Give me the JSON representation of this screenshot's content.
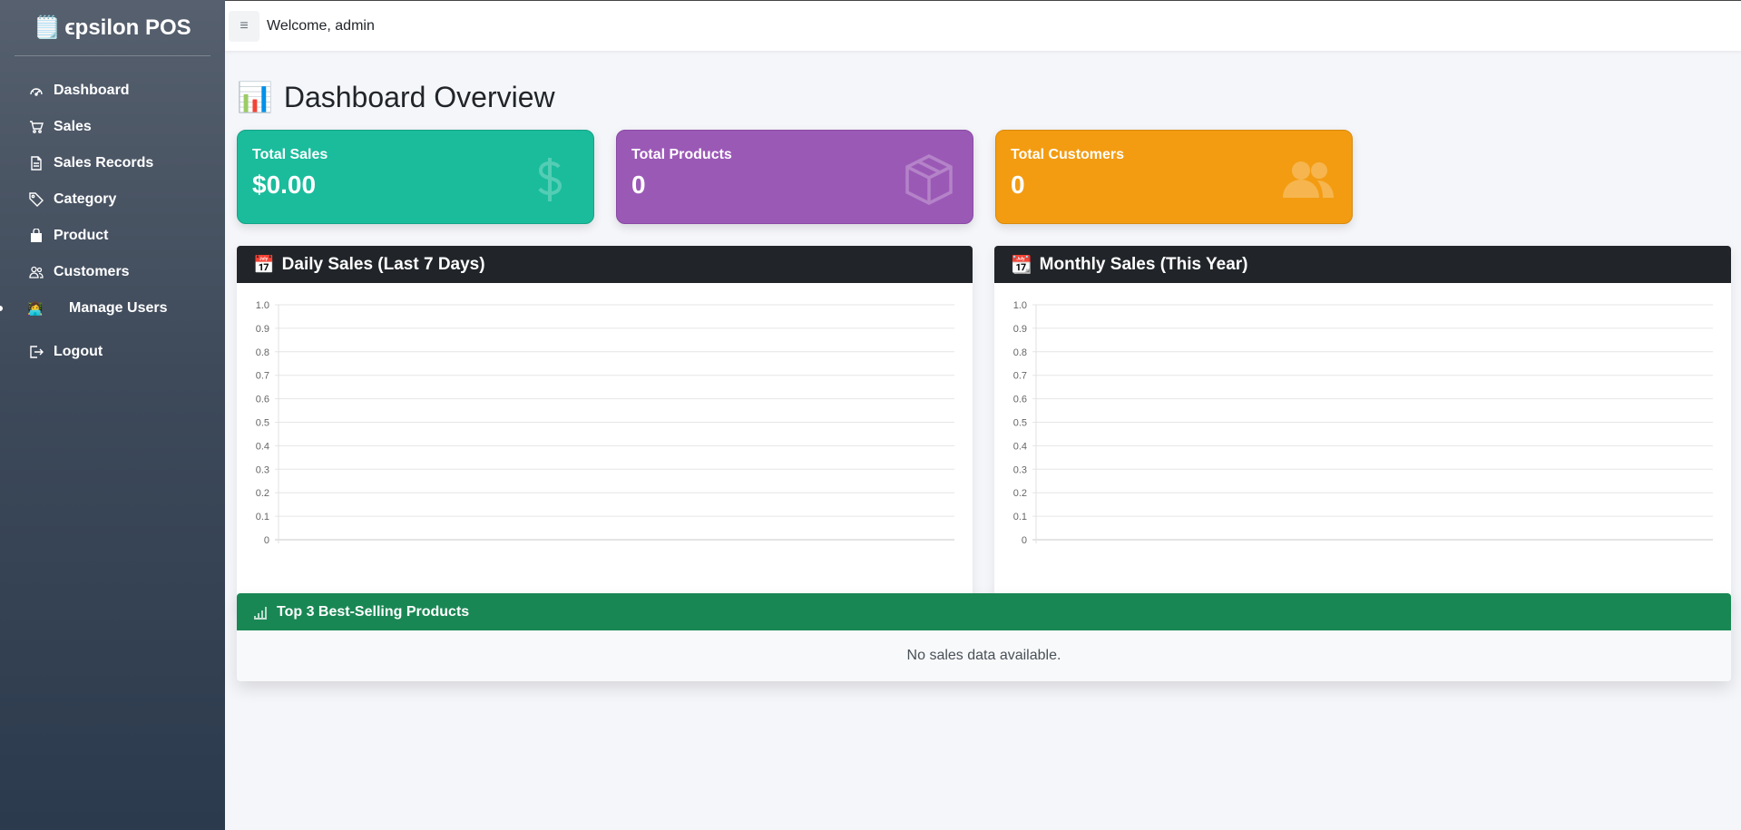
{
  "brand": {
    "icon": "🗒️",
    "name": "ϵpsilon POS"
  },
  "sidebar": {
    "items": [
      {
        "label": "Dashboard",
        "icon": "speedometer-icon"
      },
      {
        "label": "Sales",
        "icon": "cart-icon"
      },
      {
        "label": "Sales Records",
        "icon": "document-icon"
      },
      {
        "label": "Category",
        "icon": "tag-icon"
      },
      {
        "label": "Product",
        "icon": "bag-icon"
      },
      {
        "label": "Customers",
        "icon": "people-icon"
      },
      {
        "label": "Manage Users",
        "icon": "👩‍💻"
      },
      {
        "label": "Logout",
        "icon": "logout-icon"
      }
    ]
  },
  "topbar": {
    "menu_icon": "≡",
    "welcome": "Welcome, admin"
  },
  "page": {
    "title_icon": "📊",
    "title": "Dashboard Overview"
  },
  "cards": [
    {
      "label": "Total Sales",
      "value": "$0.00",
      "color": "#1abc9c",
      "icon": "dollar-icon"
    },
    {
      "label": "Total Products",
      "value": "0",
      "color": "#9b59b6",
      "icon": "box-icon"
    },
    {
      "label": "Total Customers",
      "value": "0",
      "color": "#f39c12",
      "icon": "people-icon"
    }
  ],
  "chart_data": [
    {
      "type": "line",
      "title": "Daily Sales (Last 7 Days)",
      "title_icon": "📅",
      "categories": [],
      "series": [],
      "ylim": [
        0,
        1.0
      ],
      "yticks": [
        "1.0",
        "0.9",
        "0.8",
        "0.7",
        "0.6",
        "0.5",
        "0.4",
        "0.3",
        "0.2",
        "0.1",
        "0"
      ],
      "grid": true
    },
    {
      "type": "bar",
      "title": "Monthly Sales (This Year)",
      "title_icon": "📆",
      "categories": [],
      "series": [],
      "ylim": [
        0,
        1.0
      ],
      "yticks": [
        "1.0",
        "0.9",
        "0.8",
        "0.7",
        "0.6",
        "0.5",
        "0.4",
        "0.3",
        "0.2",
        "0.1",
        "0"
      ],
      "grid": true
    }
  ],
  "best_selling": {
    "title": "Top 3 Best-Selling Products",
    "empty_text": "No sales data available.",
    "color": "#198754"
  }
}
